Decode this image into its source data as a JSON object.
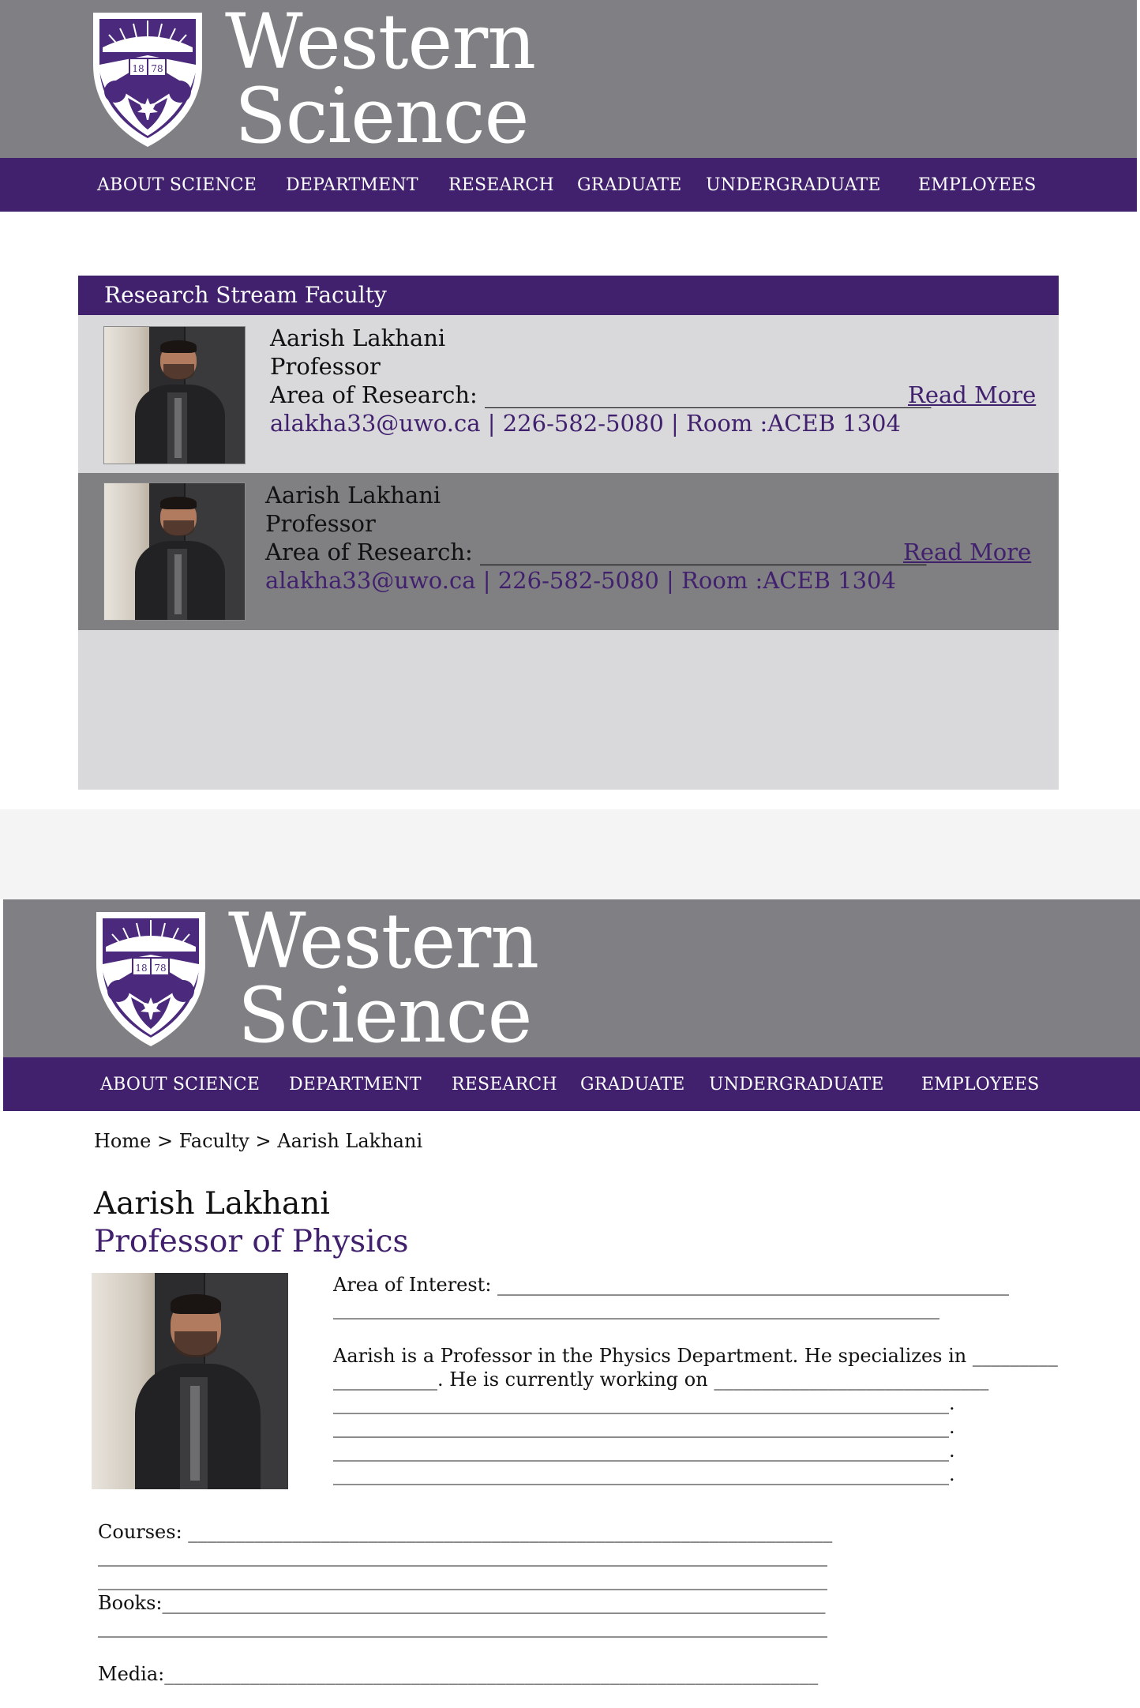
{
  "brand": {
    "line1": "Western",
    "line2": "Science",
    "crest_year_left": "18",
    "crest_year_right": "78",
    "colors": {
      "purple": "#41206e",
      "grey_header": "#807f84",
      "light_row": "#d9d9db",
      "dark_row": "#808083"
    }
  },
  "nav": {
    "items": [
      "ABOUT SCIENCE",
      "DEPARTMENT",
      "RESEARCH",
      "GRADUATE",
      "UNDERGRADUATE",
      "EMPLOYEES"
    ]
  },
  "faculty_list": {
    "title": "Research Stream Faculty",
    "rows": [
      {
        "name": "Aarish Lakhani",
        "role": "Professor",
        "area_label": "Area of Research: _______________________________________",
        "read_more": "Read More",
        "email": "alakha33@uwo.ca",
        "phone": "226-582-5080",
        "room": "Room :ACEB 1304",
        "sep": " | "
      },
      {
        "name": "Aarish Lakhani",
        "role": "Professor",
        "area_label": "Area of Research: _______________________________________",
        "read_more": "Read More",
        "email": "alakha33@uwo.ca",
        "phone": "226-582-5080",
        "room": "Room :ACEB 1304",
        "sep": " | "
      }
    ]
  },
  "profile": {
    "breadcrumb": {
      "home": "Home",
      "sep": ">",
      "faculty": "Faculty",
      "current": "Aarish Lakhani"
    },
    "name": "Aarish Lakhani",
    "title": "Professor of Physics",
    "interest_line1": "Area of Interest: ______________________________________________________",
    "interest_line2": "________________________________________________________________",
    "bio_line1": "Aarish is a Professor in the Physics Department. He specializes in _________",
    "bio_line2": "___________. He is currently working on _____________________________",
    "bio_line3": "_________________________________________________________________.",
    "bio_line4": "_________________________________________________________________.",
    "bio_line5": "_________________________________________________________________.",
    "bio_line6": "_________________________________________________________________.",
    "courses_line1": "Courses: ____________________________________________________________________",
    "courses_line2": "_____________________________________________________________________________",
    "courses_line3": "_____________________________________________________________________________",
    "books_line1": "Books:______________________________________________________________________",
    "books_line2": "_____________________________________________________________________________",
    "media_line1": "Media:_____________________________________________________________________"
  }
}
